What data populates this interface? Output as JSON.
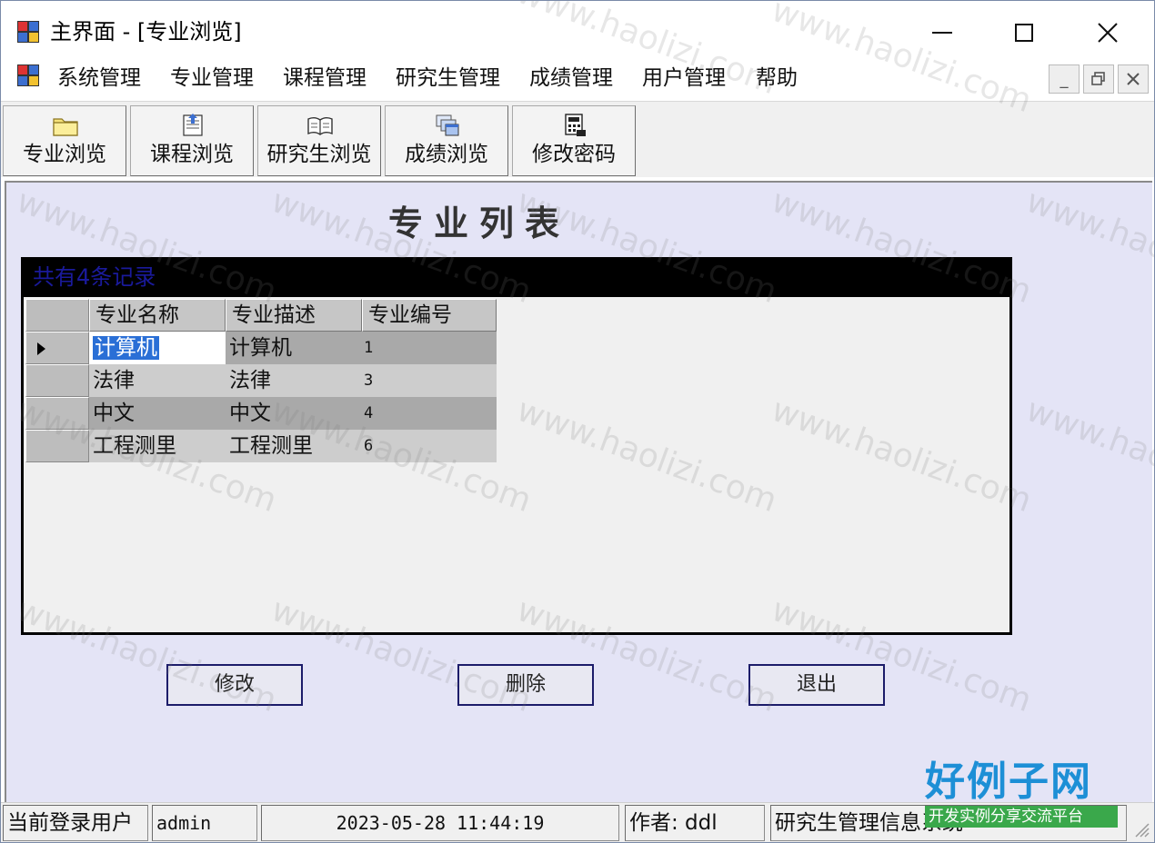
{
  "window": {
    "title": "主界面 - [专业浏览]"
  },
  "menu": {
    "items": [
      "系统管理",
      "专业管理",
      "课程管理",
      "研究生管理",
      "成绩管理",
      "用户管理",
      "帮助"
    ]
  },
  "toolbar": {
    "buttons": [
      {
        "label": "专业浏览",
        "icon": "folder-icon"
      },
      {
        "label": "课程浏览",
        "icon": "document-upload-icon"
      },
      {
        "label": "研究生浏览",
        "icon": "open-book-icon"
      },
      {
        "label": "成绩浏览",
        "icon": "stacked-windows-icon"
      },
      {
        "label": "修改密码",
        "icon": "calculator-icon"
      }
    ]
  },
  "page": {
    "title": "专业列表"
  },
  "grid": {
    "caption": "共有4条记录",
    "columns": [
      "专业名称",
      "专业描述",
      "专业编号"
    ],
    "rows": [
      [
        "计算机",
        "计算机",
        "1"
      ],
      [
        "法律",
        "法律",
        "3"
      ],
      [
        "中文",
        "中文",
        "4"
      ],
      [
        "工程测里",
        "工程测里",
        "6"
      ]
    ]
  },
  "actions": {
    "edit": "修改",
    "delete": "删除",
    "exit": "退出"
  },
  "status": {
    "user_label": "当前登录用户",
    "user": "admin",
    "datetime": "2023-05-28 11:44:19",
    "author": "作者: ddl",
    "system": "研究生管理信息系统"
  },
  "logo": {
    "main": "好例子网",
    "sub": "开发实例分享交流平台"
  },
  "watermark": "www.haolizi.com",
  "colors": {
    "client_bg": "#e4e4f6",
    "caption_text": "#1a1a9c",
    "selection": "#2a6fd6",
    "button_border": "#1c1c6a"
  }
}
